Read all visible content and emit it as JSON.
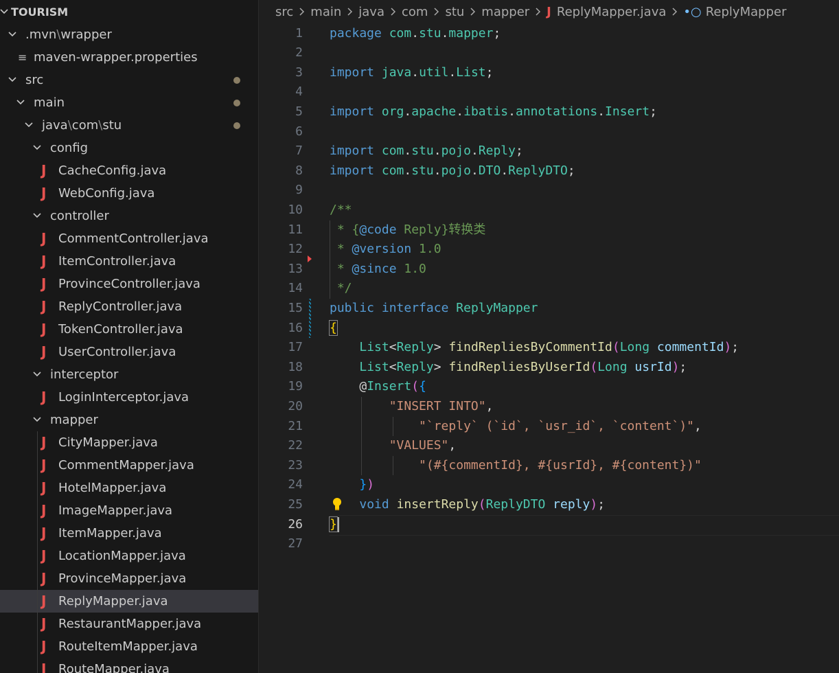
{
  "explorer": {
    "root": "TOURISM",
    "items": [
      {
        "label": ".mvn\\wrapper",
        "kind": "folder",
        "depth": 0
      },
      {
        "label": "maven-wrapper.properties",
        "kind": "props",
        "depth": 1
      },
      {
        "label": "src",
        "kind": "folder",
        "depth": 0
      },
      {
        "label": "main",
        "kind": "folder",
        "depth": 1
      },
      {
        "label": "java\\com\\stu",
        "kind": "folder",
        "depth": 2
      },
      {
        "label": "config",
        "kind": "folder",
        "depth": 3
      },
      {
        "label": "CacheConfig.java",
        "kind": "java",
        "depth": 4
      },
      {
        "label": "WebConfig.java",
        "kind": "java",
        "depth": 4
      },
      {
        "label": "controller",
        "kind": "folder",
        "depth": 3
      },
      {
        "label": "CommentController.java",
        "kind": "java",
        "depth": 4
      },
      {
        "label": "ItemController.java",
        "kind": "java",
        "depth": 4
      },
      {
        "label": "ProvinceController.java",
        "kind": "java",
        "depth": 4
      },
      {
        "label": "ReplyController.java",
        "kind": "java",
        "depth": 4
      },
      {
        "label": "TokenController.java",
        "kind": "java",
        "depth": 4
      },
      {
        "label": "UserController.java",
        "kind": "java",
        "depth": 4
      },
      {
        "label": "interceptor",
        "kind": "folder",
        "depth": 3
      },
      {
        "label": "LoginInterceptor.java",
        "kind": "java",
        "depth": 4
      },
      {
        "label": "mapper",
        "kind": "folder",
        "depth": 3
      },
      {
        "label": "CityMapper.java",
        "kind": "java",
        "depth": 4
      },
      {
        "label": "CommentMapper.java",
        "kind": "java",
        "depth": 4
      },
      {
        "label": "HotelMapper.java",
        "kind": "java",
        "depth": 4
      },
      {
        "label": "ImageMapper.java",
        "kind": "java",
        "depth": 4
      },
      {
        "label": "ItemMapper.java",
        "kind": "java",
        "depth": 4
      },
      {
        "label": "LocationMapper.java",
        "kind": "java",
        "depth": 4
      },
      {
        "label": "ProvinceMapper.java",
        "kind": "java",
        "depth": 4
      },
      {
        "label": "ReplyMapper.java",
        "kind": "java",
        "depth": 4,
        "selected": true
      },
      {
        "label": "RestaurantMapper.java",
        "kind": "java",
        "depth": 4
      },
      {
        "label": "RouteItemMapper.java",
        "kind": "java",
        "depth": 4
      },
      {
        "label": "RouteMapper.java",
        "kind": "java",
        "depth": 4
      }
    ]
  },
  "breadcrumb": [
    "src",
    "main",
    "java",
    "com",
    "stu",
    "mapper",
    "ReplyMapper.java",
    "ReplyMapper"
  ],
  "editor": {
    "current_line": 26,
    "lines": [
      [
        [
          "kw",
          "package"
        ],
        [
          "pl",
          " "
        ],
        [
          "ns",
          "com"
        ],
        [
          "pl",
          "."
        ],
        [
          "ns",
          "stu"
        ],
        [
          "pl",
          "."
        ],
        [
          "ns",
          "mapper"
        ],
        [
          "pl",
          ";"
        ]
      ],
      [],
      [
        [
          "kw",
          "import"
        ],
        [
          "pl",
          " "
        ],
        [
          "ns",
          "java"
        ],
        [
          "pl",
          "."
        ],
        [
          "ns",
          "util"
        ],
        [
          "pl",
          "."
        ],
        [
          "ty",
          "List"
        ],
        [
          "pl",
          ";"
        ]
      ],
      [],
      [
        [
          "kw",
          "import"
        ],
        [
          "pl",
          " "
        ],
        [
          "ns",
          "org"
        ],
        [
          "pl",
          "."
        ],
        [
          "ns",
          "apache"
        ],
        [
          "pl",
          "."
        ],
        [
          "ns",
          "ibatis"
        ],
        [
          "pl",
          "."
        ],
        [
          "ns",
          "annotations"
        ],
        [
          "pl",
          "."
        ],
        [
          "ty",
          "Insert"
        ],
        [
          "pl",
          ";"
        ]
      ],
      [],
      [
        [
          "kw",
          "import"
        ],
        [
          "pl",
          " "
        ],
        [
          "ns",
          "com"
        ],
        [
          "pl",
          "."
        ],
        [
          "ns",
          "stu"
        ],
        [
          "pl",
          "."
        ],
        [
          "ns",
          "pojo"
        ],
        [
          "pl",
          "."
        ],
        [
          "ty",
          "Reply"
        ],
        [
          "pl",
          ";"
        ]
      ],
      [
        [
          "kw",
          "import"
        ],
        [
          "pl",
          " "
        ],
        [
          "ns",
          "com"
        ],
        [
          "pl",
          "."
        ],
        [
          "ns",
          "stu"
        ],
        [
          "pl",
          "."
        ],
        [
          "ns",
          "pojo"
        ],
        [
          "pl",
          "."
        ],
        [
          "ns",
          "DTO"
        ],
        [
          "pl",
          "."
        ],
        [
          "ty",
          "ReplyDTO"
        ],
        [
          "pl",
          ";"
        ]
      ],
      [],
      [
        [
          "cm",
          "/**"
        ]
      ],
      [
        [
          "cm",
          " * {"
        ],
        [
          "cmt",
          "@code"
        ],
        [
          "cm",
          " Reply}转换类"
        ]
      ],
      [
        [
          "cm",
          " * "
        ],
        [
          "cmt",
          "@version"
        ],
        [
          "cm",
          " 1.0"
        ]
      ],
      [
        [
          "cm",
          " * "
        ],
        [
          "cmt",
          "@since"
        ],
        [
          "cm",
          " 1.0"
        ]
      ],
      [
        [
          "cm",
          " */"
        ]
      ],
      [
        [
          "kw",
          "public"
        ],
        [
          "pl",
          " "
        ],
        [
          "kw",
          "interface"
        ],
        [
          "pl",
          " "
        ],
        [
          "ty",
          "ReplyMapper"
        ]
      ],
      [
        [
          "y",
          "{"
        ]
      ],
      [
        [
          "pl",
          "    "
        ],
        [
          "ty",
          "List"
        ],
        [
          "pl",
          "<"
        ],
        [
          "ty",
          "Reply"
        ],
        [
          "pl",
          "> "
        ],
        [
          "fn",
          "findRepliesByCommentId"
        ],
        [
          "pk",
          "("
        ],
        [
          "ty",
          "Long"
        ],
        [
          "pl",
          " "
        ],
        [
          "pa",
          "commentId"
        ],
        [
          "pk",
          ")"
        ],
        [
          "pl",
          ";"
        ]
      ],
      [
        [
          "pl",
          "    "
        ],
        [
          "ty",
          "List"
        ],
        [
          "pl",
          "<"
        ],
        [
          "ty",
          "Reply"
        ],
        [
          "pl",
          "> "
        ],
        [
          "fn",
          "findRepliesByUserId"
        ],
        [
          "pk",
          "("
        ],
        [
          "ty",
          "Long"
        ],
        [
          "pl",
          " "
        ],
        [
          "pa",
          "usrId"
        ],
        [
          "pk",
          ")"
        ],
        [
          "pl",
          ";"
        ]
      ],
      [
        [
          "pl",
          "    @"
        ],
        [
          "ty",
          "Insert"
        ],
        [
          "pk",
          "("
        ],
        [
          "bl",
          "{"
        ]
      ],
      [
        [
          "pl",
          "        "
        ],
        [
          "st",
          "\"INSERT INTO\""
        ],
        [
          "pl",
          ","
        ]
      ],
      [
        [
          "pl",
          "            "
        ],
        [
          "st",
          "\"`reply` (`id`, `usr_id`, `content`)\""
        ],
        [
          "pl",
          ","
        ]
      ],
      [
        [
          "pl",
          "        "
        ],
        [
          "st",
          "\"VALUES\""
        ],
        [
          "pl",
          ","
        ]
      ],
      [
        [
          "pl",
          "            "
        ],
        [
          "st",
          "\"(#{commentId}, #{usrId}, #{content})\""
        ]
      ],
      [
        [
          "pl",
          "    "
        ],
        [
          "bl",
          "}"
        ],
        [
          "pk",
          ")"
        ]
      ],
      [
        [
          "pl",
          "    "
        ],
        [
          "kw",
          "void"
        ],
        [
          "pl",
          " "
        ],
        [
          "fn",
          "insertReply"
        ],
        [
          "pk",
          "("
        ],
        [
          "ty",
          "ReplyDTO"
        ],
        [
          "pl",
          " "
        ],
        [
          "pa",
          "reply"
        ],
        [
          "pk",
          ")"
        ],
        [
          "pl",
          ";"
        ]
      ],
      [
        [
          "y",
          "}"
        ]
      ],
      []
    ]
  },
  "colors": {
    "accent": "#0078d4",
    "java_icon": "#e5524f",
    "modified_dot": "#8a7e65"
  }
}
